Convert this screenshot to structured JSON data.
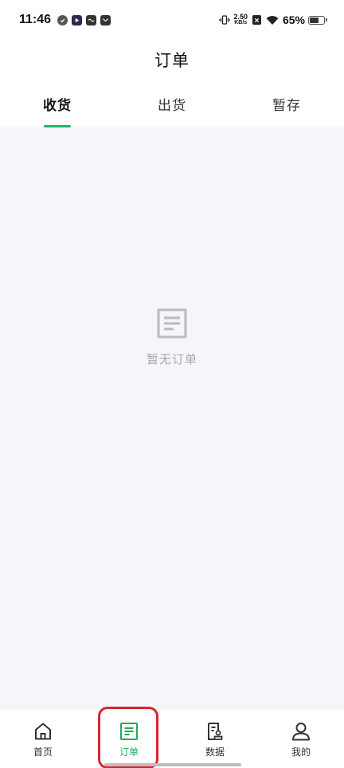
{
  "status_bar": {
    "time": "11:46",
    "net_speed_value": "2.50",
    "net_speed_unit": "KB/s",
    "battery_percent": "65%",
    "battery_level": 0.65
  },
  "header": {
    "title": "订单"
  },
  "tabs": [
    {
      "label": "收货",
      "active": true
    },
    {
      "label": "出货",
      "active": false
    },
    {
      "label": "暂存",
      "active": false
    }
  ],
  "empty_state": {
    "text": "暂无订单",
    "icon": "document-lines-icon"
  },
  "bottom_nav": {
    "items": [
      {
        "label": "首页",
        "icon": "home-icon"
      },
      {
        "label": "订单",
        "icon": "order-icon",
        "active": true
      },
      {
        "label": "数据",
        "icon": "data-report-icon"
      },
      {
        "label": "我的",
        "icon": "user-icon"
      }
    ]
  },
  "colors": {
    "accent": "#22b566",
    "highlight": "#d9262b",
    "content_bg": "#f5f6fa",
    "empty_text": "#a6a8ad"
  }
}
